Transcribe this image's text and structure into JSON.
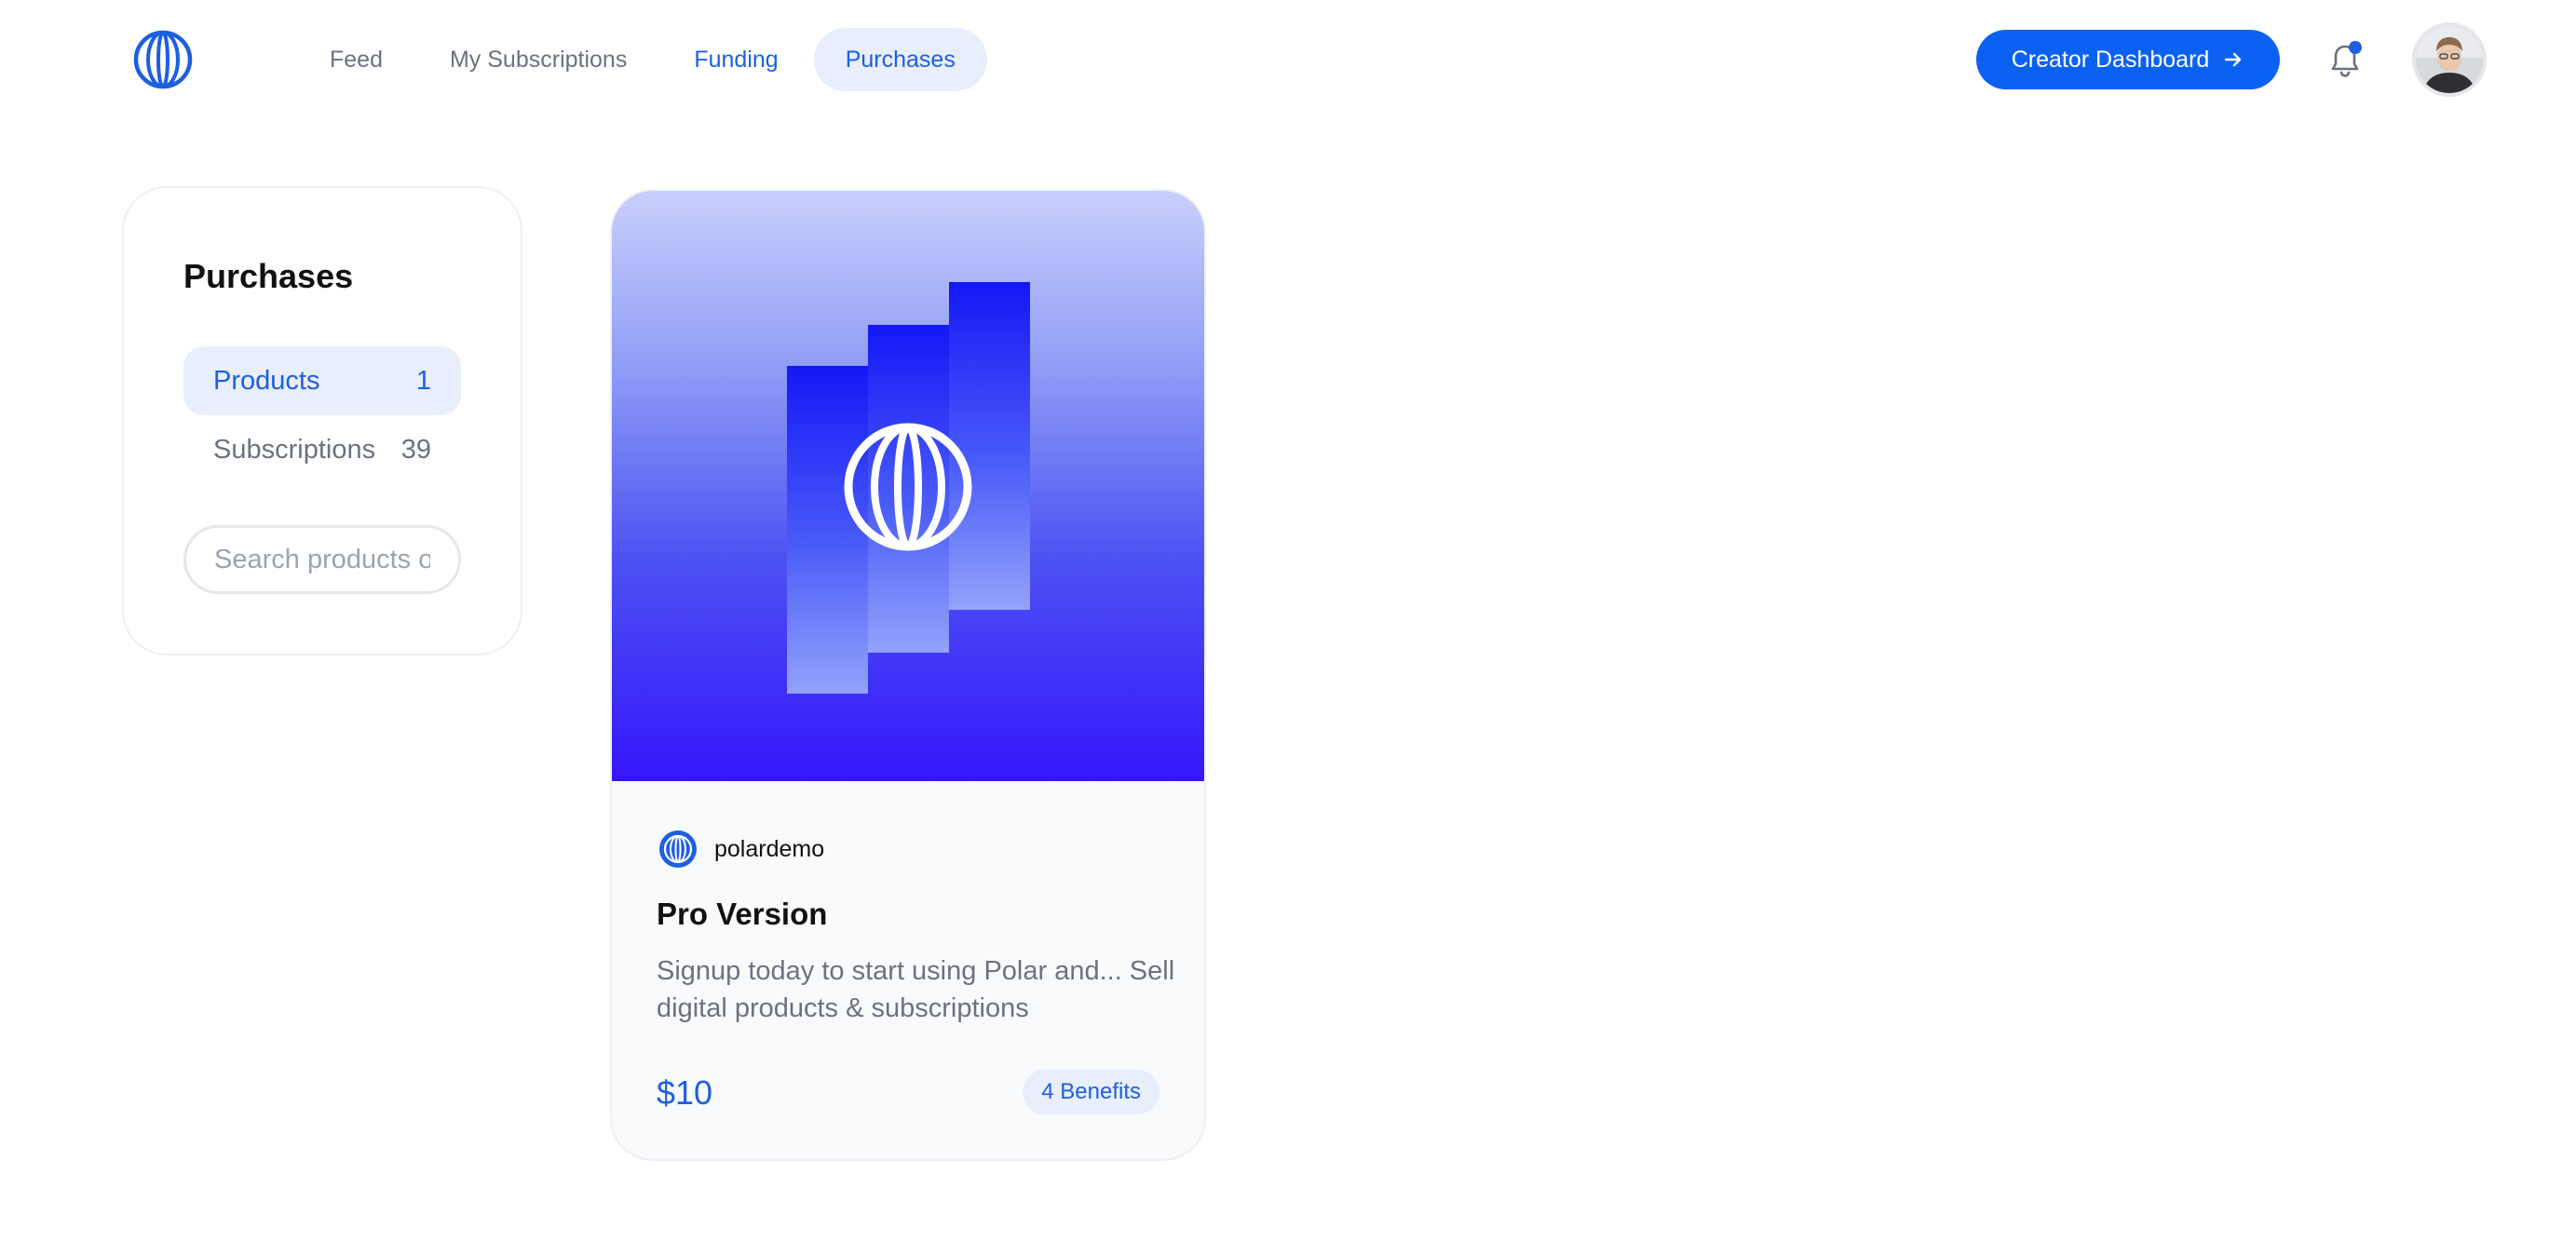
{
  "nav": {
    "items": [
      {
        "label": "Feed"
      },
      {
        "label": "My Subscriptions"
      },
      {
        "label": "Funding"
      },
      {
        "label": "Purchases"
      }
    ],
    "active": "Purchases"
  },
  "header": {
    "cta_label": "Creator Dashboard",
    "cta_icon": "arrow-right-icon",
    "notification_icon": "bell-icon",
    "has_unread_notifications": true
  },
  "sidebar": {
    "title": "Purchases",
    "items": [
      {
        "label": "Products",
        "count": "1"
      },
      {
        "label": "Subscriptions",
        "count": "39"
      }
    ],
    "search_placeholder": "Search products or subscriptions"
  },
  "products": [
    {
      "org_name": "polardemo",
      "title": "Pro Version",
      "description": "Signup today to start using Polar and... Sell digital products & subscriptions",
      "price": "$10",
      "benefits": "4 Benefits"
    }
  ],
  "colors": {
    "accent": "#0b62f2",
    "accent_text": "#1d5fe0",
    "active_bg": "#e8eefc",
    "muted_text": "#6b7280"
  }
}
